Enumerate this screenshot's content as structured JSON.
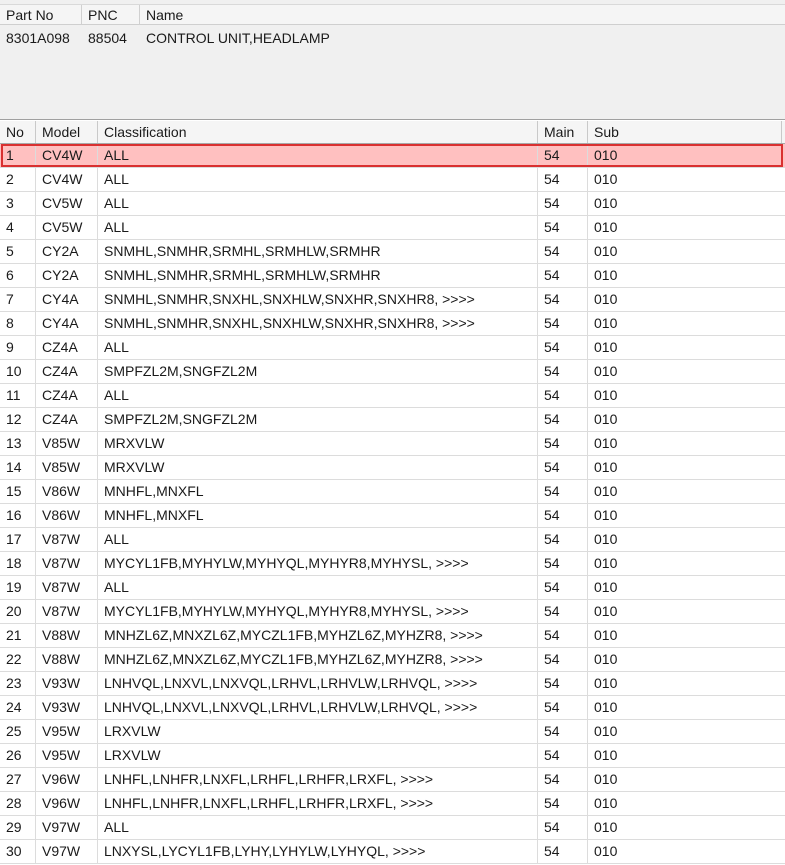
{
  "part_panel": {
    "columns": {
      "part_no": "Part No",
      "pnc": "PNC",
      "name": "Name"
    },
    "row": {
      "part_no": "8301A098",
      "pnc": "88504",
      "name": "CONTROL UNIT,HEADLAMP"
    }
  },
  "grid": {
    "columns": {
      "no": "No",
      "model": "Model",
      "classification": "Classification",
      "main": "Main",
      "sub": "Sub"
    },
    "selected_row": 1,
    "colors": {
      "selected_fill": "#ffc0c0",
      "selected_border": "#d93030"
    },
    "rows": [
      {
        "no": "1",
        "model": "CV4W",
        "classification": "ALL",
        "main": "54",
        "sub": "010"
      },
      {
        "no": "2",
        "model": "CV4W",
        "classification": "ALL",
        "main": "54",
        "sub": "010"
      },
      {
        "no": "3",
        "model": "CV5W",
        "classification": "ALL",
        "main": "54",
        "sub": "010"
      },
      {
        "no": "4",
        "model": "CV5W",
        "classification": "ALL",
        "main": "54",
        "sub": "010"
      },
      {
        "no": "5",
        "model": "CY2A",
        "classification": "SNMHL,SNMHR,SRMHL,SRMHLW,SRMHR",
        "main": "54",
        "sub": "010"
      },
      {
        "no": "6",
        "model": "CY2A",
        "classification": "SNMHL,SNMHR,SRMHL,SRMHLW,SRMHR",
        "main": "54",
        "sub": "010"
      },
      {
        "no": "7",
        "model": "CY4A",
        "classification": "SNMHL,SNMHR,SNXHL,SNXHLW,SNXHR,SNXHR8,  >>>>",
        "main": "54",
        "sub": "010"
      },
      {
        "no": "8",
        "model": "CY4A",
        "classification": "SNMHL,SNMHR,SNXHL,SNXHLW,SNXHR,SNXHR8,  >>>>",
        "main": "54",
        "sub": "010"
      },
      {
        "no": "9",
        "model": "CZ4A",
        "classification": "ALL",
        "main": "54",
        "sub": "010"
      },
      {
        "no": "10",
        "model": "CZ4A",
        "classification": "SMPFZL2M,SNGFZL2M",
        "main": "54",
        "sub": "010"
      },
      {
        "no": "11",
        "model": "CZ4A",
        "classification": "ALL",
        "main": "54",
        "sub": "010"
      },
      {
        "no": "12",
        "model": "CZ4A",
        "classification": "SMPFZL2M,SNGFZL2M",
        "main": "54",
        "sub": "010"
      },
      {
        "no": "13",
        "model": "V85W",
        "classification": "MRXVLW",
        "main": "54",
        "sub": "010"
      },
      {
        "no": "14",
        "model": "V85W",
        "classification": "MRXVLW",
        "main": "54",
        "sub": "010"
      },
      {
        "no": "15",
        "model": "V86W",
        "classification": "MNHFL,MNXFL",
        "main": "54",
        "sub": "010"
      },
      {
        "no": "16",
        "model": "V86W",
        "classification": "MNHFL,MNXFL",
        "main": "54",
        "sub": "010"
      },
      {
        "no": "17",
        "model": "V87W",
        "classification": "ALL",
        "main": "54",
        "sub": "010"
      },
      {
        "no": "18",
        "model": "V87W",
        "classification": "MYCYL1FB,MYHYLW,MYHYQL,MYHYR8,MYHYSL,  >>>>",
        "main": "54",
        "sub": "010"
      },
      {
        "no": "19",
        "model": "V87W",
        "classification": "ALL",
        "main": "54",
        "sub": "010"
      },
      {
        "no": "20",
        "model": "V87W",
        "classification": "MYCYL1FB,MYHYLW,MYHYQL,MYHYR8,MYHYSL,  >>>>",
        "main": "54",
        "sub": "010"
      },
      {
        "no": "21",
        "model": "V88W",
        "classification": "MNHZL6Z,MNXZL6Z,MYCZL1FB,MYHZL6Z,MYHZR8,  >>>>",
        "main": "54",
        "sub": "010"
      },
      {
        "no": "22",
        "model": "V88W",
        "classification": "MNHZL6Z,MNXZL6Z,MYCZL1FB,MYHZL6Z,MYHZR8,  >>>>",
        "main": "54",
        "sub": "010"
      },
      {
        "no": "23",
        "model": "V93W",
        "classification": "LNHVQL,LNXVL,LNXVQL,LRHVL,LRHVLW,LRHVQL,  >>>>",
        "main": "54",
        "sub": "010"
      },
      {
        "no": "24",
        "model": "V93W",
        "classification": "LNHVQL,LNXVL,LNXVQL,LRHVL,LRHVLW,LRHVQL,  >>>>",
        "main": "54",
        "sub": "010"
      },
      {
        "no": "25",
        "model": "V95W",
        "classification": "LRXVLW",
        "main": "54",
        "sub": "010"
      },
      {
        "no": "26",
        "model": "V95W",
        "classification": "LRXVLW",
        "main": "54",
        "sub": "010"
      },
      {
        "no": "27",
        "model": "V96W",
        "classification": "LNHFL,LNHFR,LNXFL,LRHFL,LRHFR,LRXFL,  >>>>",
        "main": "54",
        "sub": "010"
      },
      {
        "no": "28",
        "model": "V96W",
        "classification": "LNHFL,LNHFR,LNXFL,LRHFL,LRHFR,LRXFL,  >>>>",
        "main": "54",
        "sub": "010"
      },
      {
        "no": "29",
        "model": "V97W",
        "classification": "ALL",
        "main": "54",
        "sub": "010"
      },
      {
        "no": "30",
        "model": "V97W",
        "classification": "LNXYSL,LYCYL1FB,LYHY,LYHYLW,LYHYQL,  >>>>",
        "main": "54",
        "sub": "010"
      }
    ]
  }
}
